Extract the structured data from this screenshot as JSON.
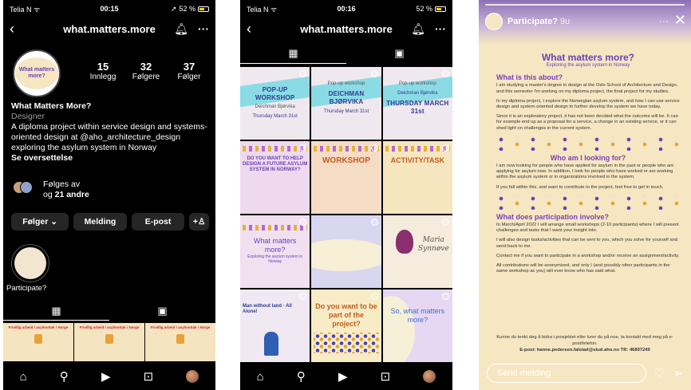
{
  "status_bar_1": {
    "carrier": "Telia N",
    "time": "00:15",
    "battery": "52 %"
  },
  "status_bar_2": {
    "carrier": "Telia N",
    "time": "00:16",
    "battery": "52 %"
  },
  "profile": {
    "username": "what.matters.more",
    "avatar_text": "What matters more?",
    "stats": [
      {
        "value": "15",
        "label": "Innlegg"
      },
      {
        "value": "32",
        "label": "Følgere"
      },
      {
        "value": "37",
        "label": "Følger"
      }
    ],
    "name": "What Matters More?",
    "category": "Designer",
    "bio": "A diploma project within service design and systems-oriented design at @aho_architecture_design exploring the asylum system in Norway",
    "translate": "Se oversettelse",
    "followed_by_prefix": "Følges av",
    "followed_by_rest": "og",
    "followed_by_count": "21 andre",
    "buttons": {
      "following": "Følger ⌄",
      "message": "Melding",
      "email": "E-post",
      "add_person": "+♙"
    },
    "highlight_label": "Participate?",
    "grid_tab_icon": "grid-icon",
    "tagged_tab_icon": "tagged-icon",
    "bottom_grid": [
      "Frivillig arbeid i asylmottak i Norge",
      "Frivillig arbeid i asylmottak i Norge",
      "Frivillig arbeid i asylmottak i Norge"
    ]
  },
  "grid_posts": [
    {
      "title": "POP-UP WORKSHOP",
      "place": "Deichman Bjørvika",
      "date": "Thursday March 31st"
    },
    {
      "title": "DEICHMAN BJØRVIKA",
      "place": "Pop-up workshop",
      "date": "Thursday March 31st"
    },
    {
      "title": "THURSDAY MARCH 31st",
      "place": "Pop-up workshop",
      "date": "Deichman Bjørvika"
    },
    {
      "title": "DO YOU WANT TO HELP DESIGN A FUTURE ASYLUM SYSTEM IN NORWAY?"
    },
    {
      "title": "WORKSHOP"
    },
    {
      "title": "ACTIVITY/TASK"
    },
    {
      "title": "What matters more?",
      "sub": "Exploring the asylum system in Norway"
    },
    {
      "title": ""
    },
    {
      "title": "Maria Synnøve"
    },
    {
      "title": "Man without land - All Alone!"
    },
    {
      "title": "Do you want to be part of the project?"
    },
    {
      "title": "So, what matters more?"
    }
  ],
  "story": {
    "account": "Participate?",
    "time": "9u",
    "title": "What matters more?",
    "subtitle": "Exploring the asylum system in Norway",
    "h_about": "What is this about?",
    "p_about_1": "I am studying a master's degree in design at the Oslo School of Architecture and Design, and this semester I'm working on my diploma project, the final project for my studies.",
    "p_about_2": "In my diploma project, I explore the Norwegian asylum system, and how I can use service design and system-oriented design to further develop the system we have today.",
    "p_about_3": "Since it is an exploratory project, it has not been decided what the outcome will be. It can for example end up as a proposal for a service, a change in an existing service, or it can shed light on challenges in the current system.",
    "h_who": "Who am I looking for?",
    "p_who_1": "I am now looking for people who have applied for asylum in the past or people who are applying for asylum now. In addition, I look for people who have worked or are working within the asylum system or in organizations involved in the system.",
    "p_who_2": "If you fall within this, and want to contribute to the project, feel free to get in touch.",
    "h_part": "What does participation involve?",
    "p_part_1": "In March/April 2022 I will arrange small workshops (2-10 participants) where I will present challenges and tasks that I want your insight into.",
    "p_part_2": "I will also design tasks/activities that can be sent to you, which you solve for yourself and send back to me.",
    "p_part_3": "Contact me if you want to participate in a workshop and/or receive an assignment/activity.",
    "p_part_4": "All contributions will be anonymized, and only I (and possibly other participants in the same workshop as you) will ever know who has said what.",
    "contact_line": "Kunne du tenkt deg å bidra i prosjektet eller lurer du på noe, ta kontakt med meg på e-post/telefon.",
    "contact_details": "E-post: hanne.pedersen.falstad@stud.aho.no      TR: 46897249",
    "reply_placeholder": "Send melding"
  },
  "colors": {
    "accent_purple": "#6a3fb8",
    "story_bg": "#f6e7c2",
    "button_bg": "#262626"
  }
}
